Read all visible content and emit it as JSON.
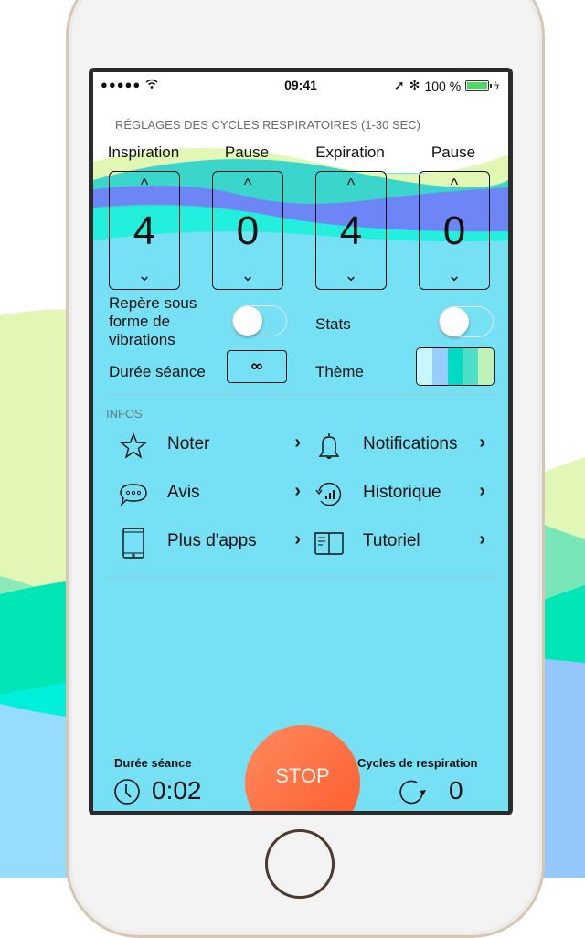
{
  "status_bar": {
    "signal": "●●●●●",
    "wifi_icon": "wifi-icon",
    "time": "09:41",
    "location_icon": "location-arrow-icon",
    "bluetooth_icon": "bluetooth-icon",
    "battery_text": "100 %",
    "battery_level": 1.0,
    "charging_icon": "bolt-icon"
  },
  "settings": {
    "section_title": "RÉGLAGES DES CYCLES RESPIRATOIRES (1-30 SEC)",
    "pickers": [
      {
        "label": "Inspiration",
        "value": "4"
      },
      {
        "label": "Pause",
        "value": "0"
      },
      {
        "label": "Expiration",
        "value": "4"
      },
      {
        "label": "Pause",
        "value": "0"
      }
    ],
    "up_glyph": "^",
    "down_glyph": "⌄",
    "vibration_label_lines": [
      "Repère sous",
      "forme de",
      "vibrations"
    ],
    "vibration_on": false,
    "stats_label": "Stats",
    "stats_on": false,
    "duration_label": "Durée séance",
    "duration_value": "∞",
    "theme_label": "Thème",
    "theme_colors": [
      "#c8f6ff",
      "#99ccff",
      "#00d9c4",
      "#4de0c8",
      "#bff2b8"
    ]
  },
  "infos": {
    "title": "INFOS",
    "items": [
      {
        "label": "Noter",
        "icon": "star-icon"
      },
      {
        "label": "Notifications",
        "icon": "bell-icon"
      },
      {
        "label": "Avis",
        "icon": "chat-bubble-icon"
      },
      {
        "label": "Historique",
        "icon": "history-chart-icon"
      },
      {
        "label": "Plus d'apps",
        "icon": "phone-icon"
      },
      {
        "label": "Tutoriel",
        "icon": "book-icon"
      }
    ],
    "chevron": "›"
  },
  "footer": {
    "duration_label": "Durée séance",
    "duration_value": "0:02",
    "stop_label": "STOP",
    "cycles_label": "Cycles de respiration",
    "cycles_value": "0"
  },
  "colors": {
    "screen_bg": "#76e0f4",
    "stop": "#ff6a3d",
    "wave_lime": "#e2f7b4",
    "wave_teal": "#3ad6cc",
    "wave_indigo": "#6e85f5",
    "wave_aqua": "#22f0dc"
  }
}
